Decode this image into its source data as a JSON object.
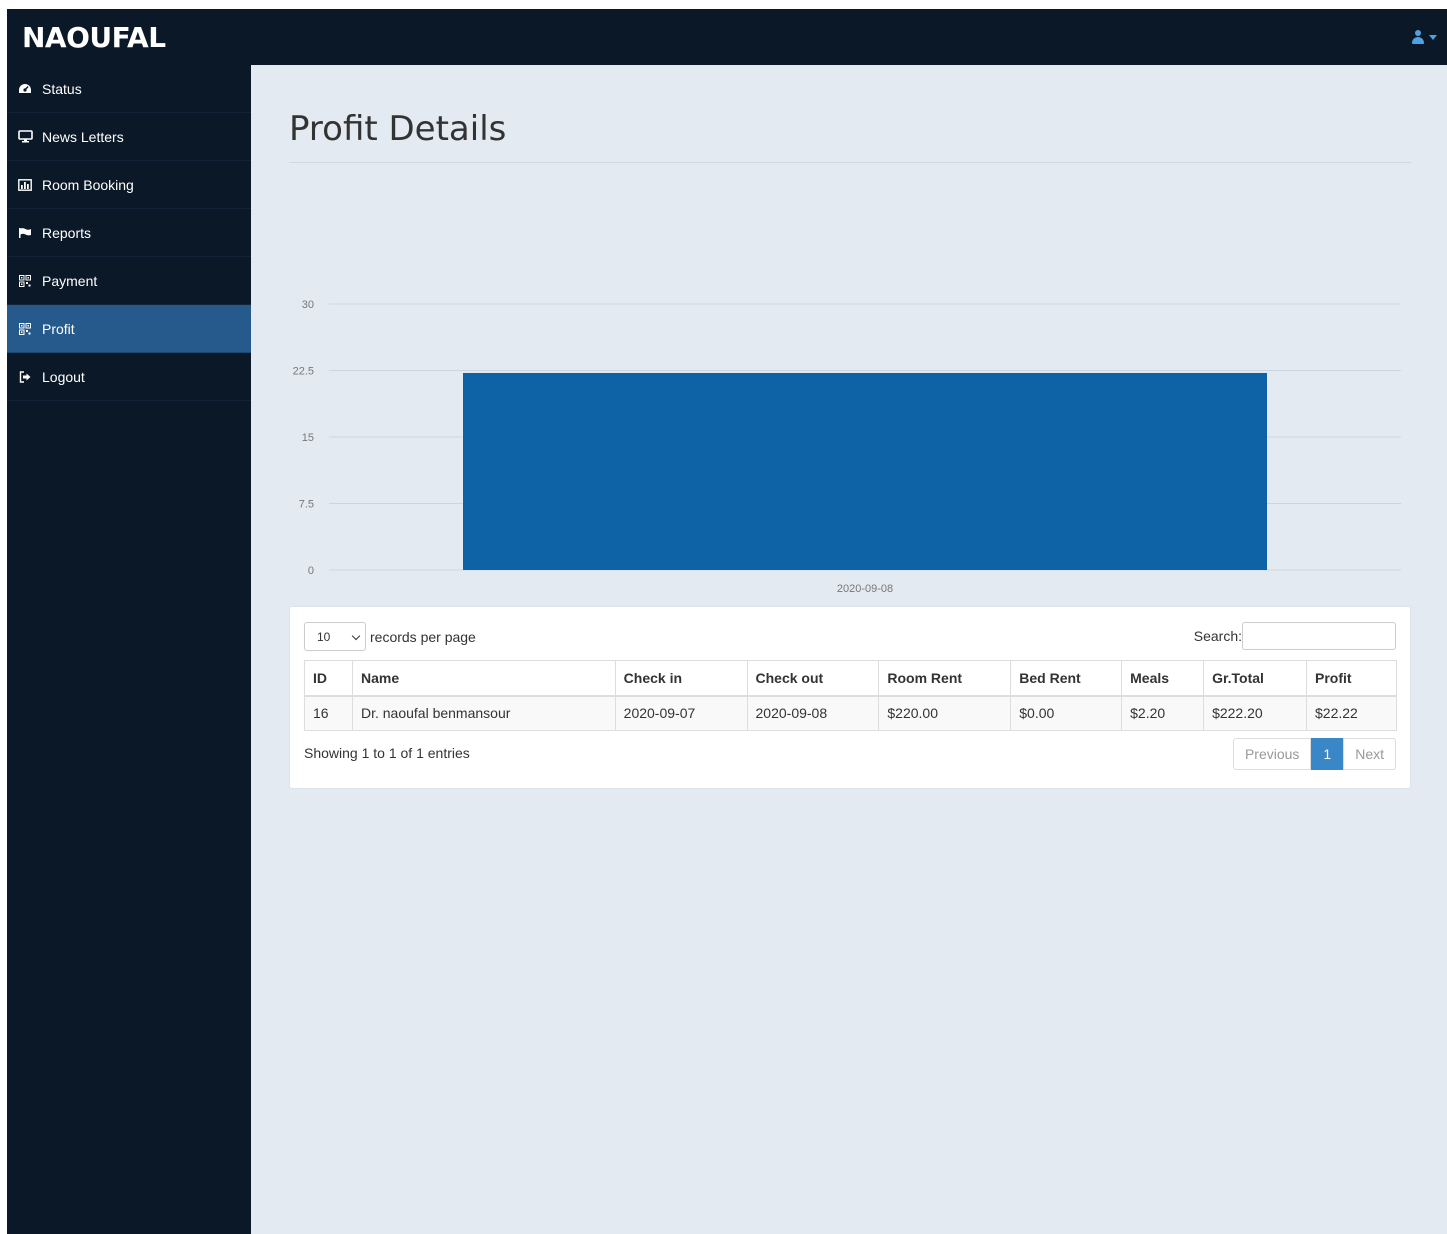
{
  "brand": "NAOUFAL",
  "sidebar": {
    "items": [
      {
        "label": "Status",
        "icon": "dashboard-icon"
      },
      {
        "label": "News Letters",
        "icon": "desktop-icon"
      },
      {
        "label": "Room Booking",
        "icon": "bar-chart-icon"
      },
      {
        "label": "Reports",
        "icon": "flag-icon"
      },
      {
        "label": "Payment",
        "icon": "qrcode-icon"
      },
      {
        "label": "Profit",
        "icon": "qrcode-icon",
        "active": true
      },
      {
        "label": "Logout",
        "icon": "sign-out-icon"
      }
    ]
  },
  "page": {
    "title": "Profit Details"
  },
  "chart_data": {
    "type": "bar",
    "categories": [
      "2020-09-08"
    ],
    "values": [
      22.22
    ],
    "ylim": [
      0,
      30
    ],
    "yticks": [
      "0",
      "7.5",
      "15",
      "22.5",
      "30"
    ],
    "color": "#0d63a5",
    "grid": true
  },
  "table": {
    "length_value": "10",
    "length_label": "records per page",
    "search_label": "Search:",
    "search_value": "",
    "columns": [
      "ID",
      "Name",
      "Check in",
      "Check out",
      "Room Rent",
      "Bed Rent",
      "Meals",
      "Gr.Total",
      "Profit"
    ],
    "rows": [
      [
        "16",
        "Dr. naoufal benmansour",
        "2020-09-07",
        "2020-09-08",
        "$220.00",
        "$0.00",
        "$2.20",
        "$222.20",
        "$22.22"
      ]
    ],
    "info": "Showing 1 to 1 of 1 entries",
    "pagination": {
      "previous": "Previous",
      "current": "1",
      "next": "Next"
    }
  },
  "colors": {
    "navbar": "#0b1828",
    "active_item": "#265a8c",
    "bar": "#0d63a5",
    "page_bg": "#e4eaf2"
  }
}
